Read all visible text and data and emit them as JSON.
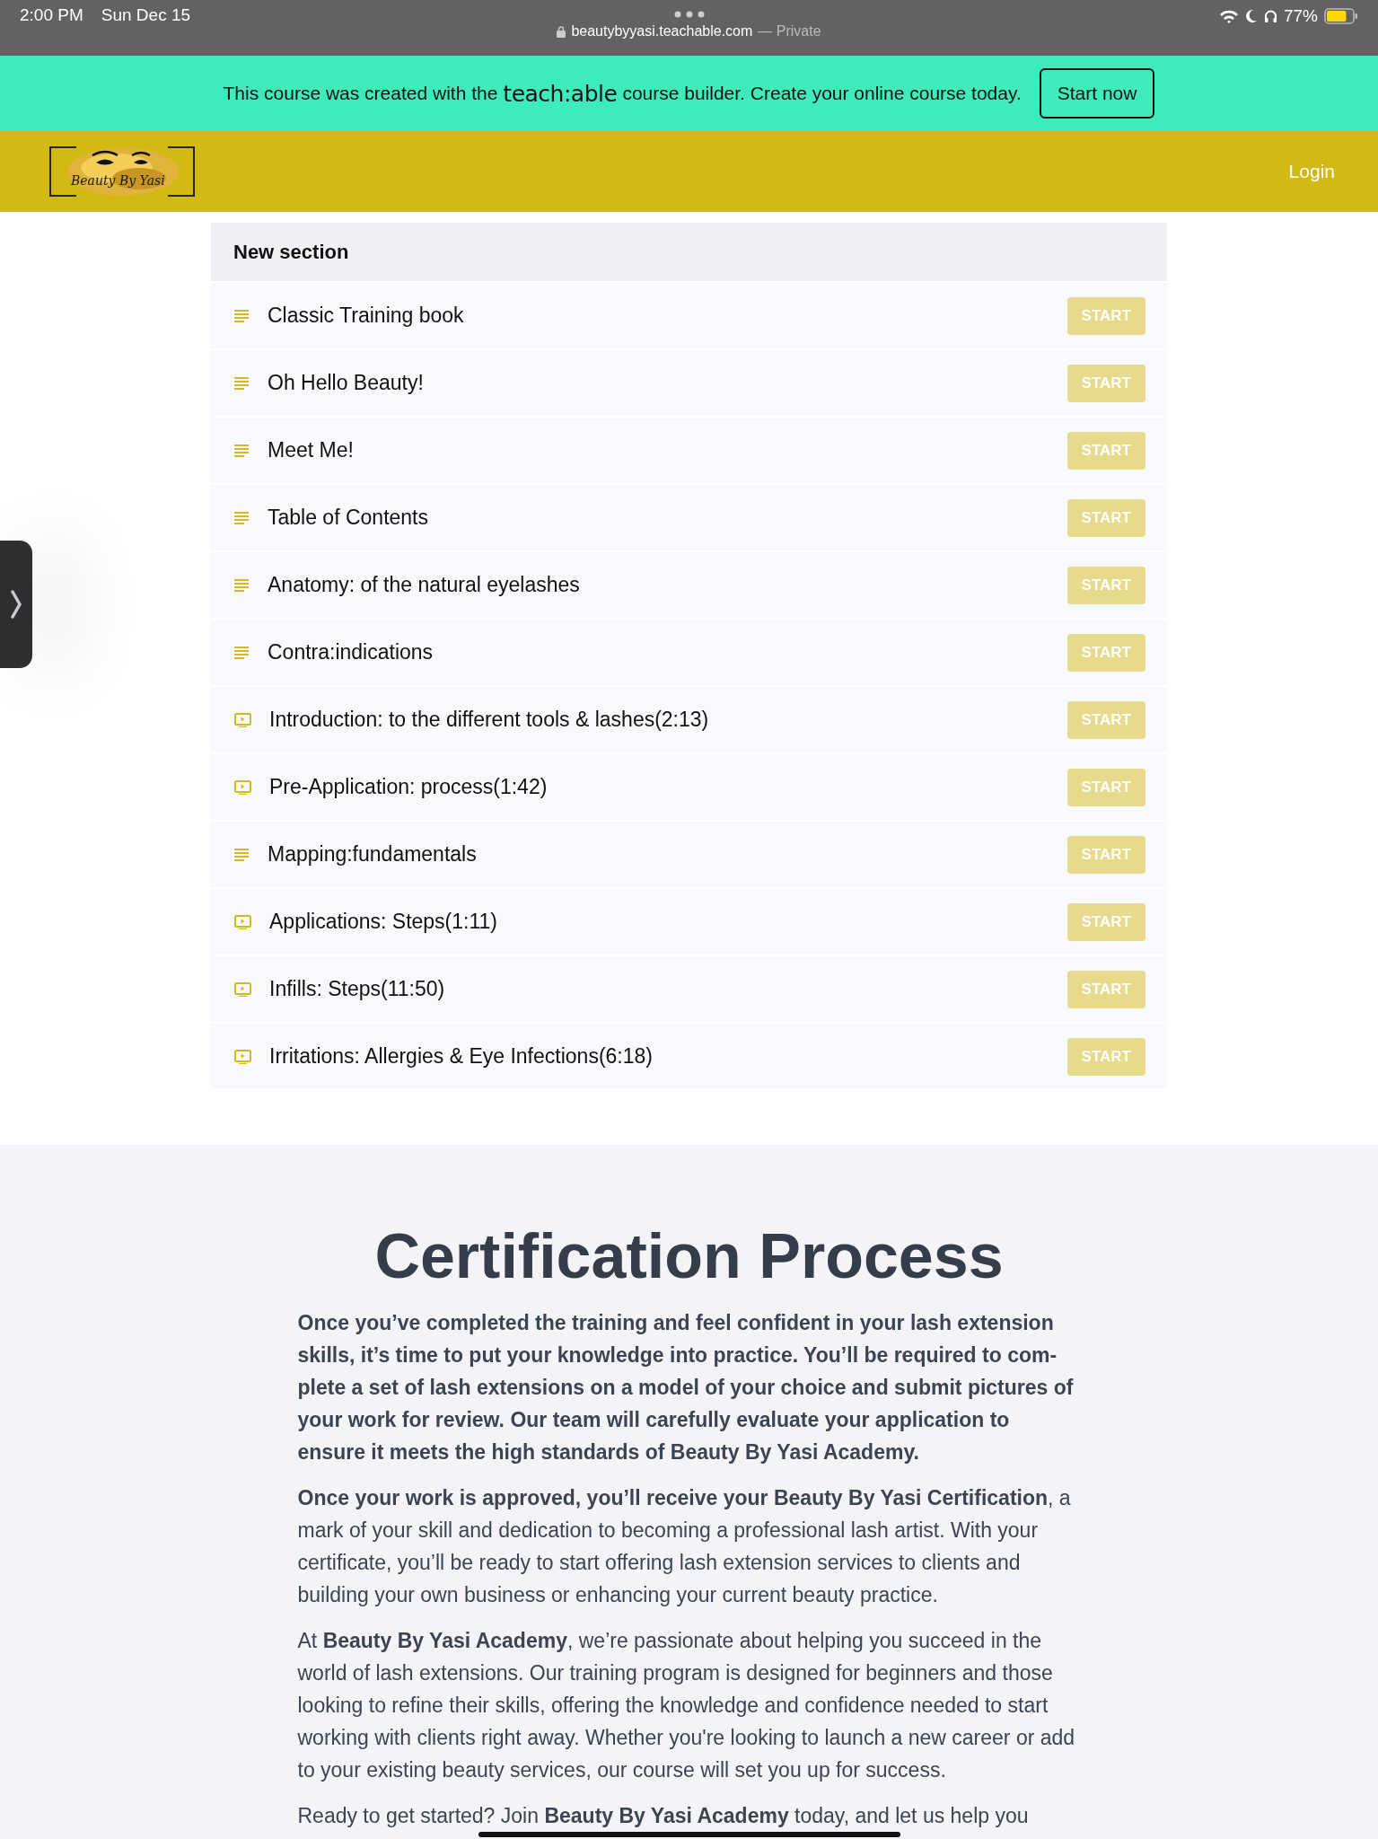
{
  "status_bar": {
    "time": "2:00 PM",
    "date": "Sun Dec 15",
    "url": "beautybyyasi.teachable.com",
    "privacy": "— Private",
    "battery_text": "77%"
  },
  "banner": {
    "text_before": "This course was created with the",
    "brand": "teach:able",
    "text_after": "course builder. Create your online course today.",
    "button": "Start now"
  },
  "header": {
    "logo_text": "Beauty By Yasi",
    "login": "Login"
  },
  "section": {
    "title": "New section",
    "lessons": [
      {
        "kind": "text",
        "title": "Classic Training book",
        "action": "START"
      },
      {
        "kind": "text",
        "title": "Oh Hello Beauty!",
        "action": "START"
      },
      {
        "kind": "text",
        "title": "Meet Me!",
        "action": "START"
      },
      {
        "kind": "text",
        "title": "Table of Contents",
        "action": "START"
      },
      {
        "kind": "text",
        "title": "Anatomy: of the natural eyelashes",
        "action": "START"
      },
      {
        "kind": "text",
        "title": "Contra:indications",
        "action": "START"
      },
      {
        "kind": "video",
        "title": "Introduction: to the different tools & lashes(2:13)",
        "action": "START"
      },
      {
        "kind": "video",
        "title": "Pre-Application: process(1:42)",
        "action": "START"
      },
      {
        "kind": "text",
        "title": "Mapping:fundamentals",
        "action": "START"
      },
      {
        "kind": "video",
        "title": "Applications: Steps(1:11)",
        "action": "START"
      },
      {
        "kind": "video",
        "title": "Infills: Steps(11:50)",
        "action": "START"
      },
      {
        "kind": "video",
        "title": "Irritations: Allergies & Eye Infections(6:18)",
        "action": "START"
      }
    ]
  },
  "certification": {
    "title": "Certification Process",
    "paragraphs": [
      {
        "bold": true,
        "text": "Once you’ve completed the training and feel confident in your lash extension skills, it’s time to put your knowledge into practice. You’ll be required to com-plete a set of lash extensions on a model of your choice and submit pictures of your work for review. Our team will carefully evaluate your application to ensure it meets the high standards of Beauty By Yasi Academy."
      },
      {
        "bold": false,
        "text": "**Once your work is approved, you’ll receive your Beauty By Yasi Certification**, a mark of your skill and dedication to becoming a professional lash artist. With your certificate, you’ll be ready to start offering lash extension services to clients and building your own business or enhancing your current beauty practice."
      },
      {
        "bold": false,
        "text": "At **Beauty By Yasi Academy**, we’re passionate about helping you succeed in the world of lash extensions. Our training program is designed for beginners and those looking to refine their skills, offering the knowledge and confidence needed to start working with clients right away. Whether you're looking to launch a new career or add to your existing beauty services, our course will set you up for success."
      },
      {
        "bold": false,
        "text": "Ready to get started? Join **Beauty By Yasi Academy** today, and let us help you"
      }
    ]
  }
}
